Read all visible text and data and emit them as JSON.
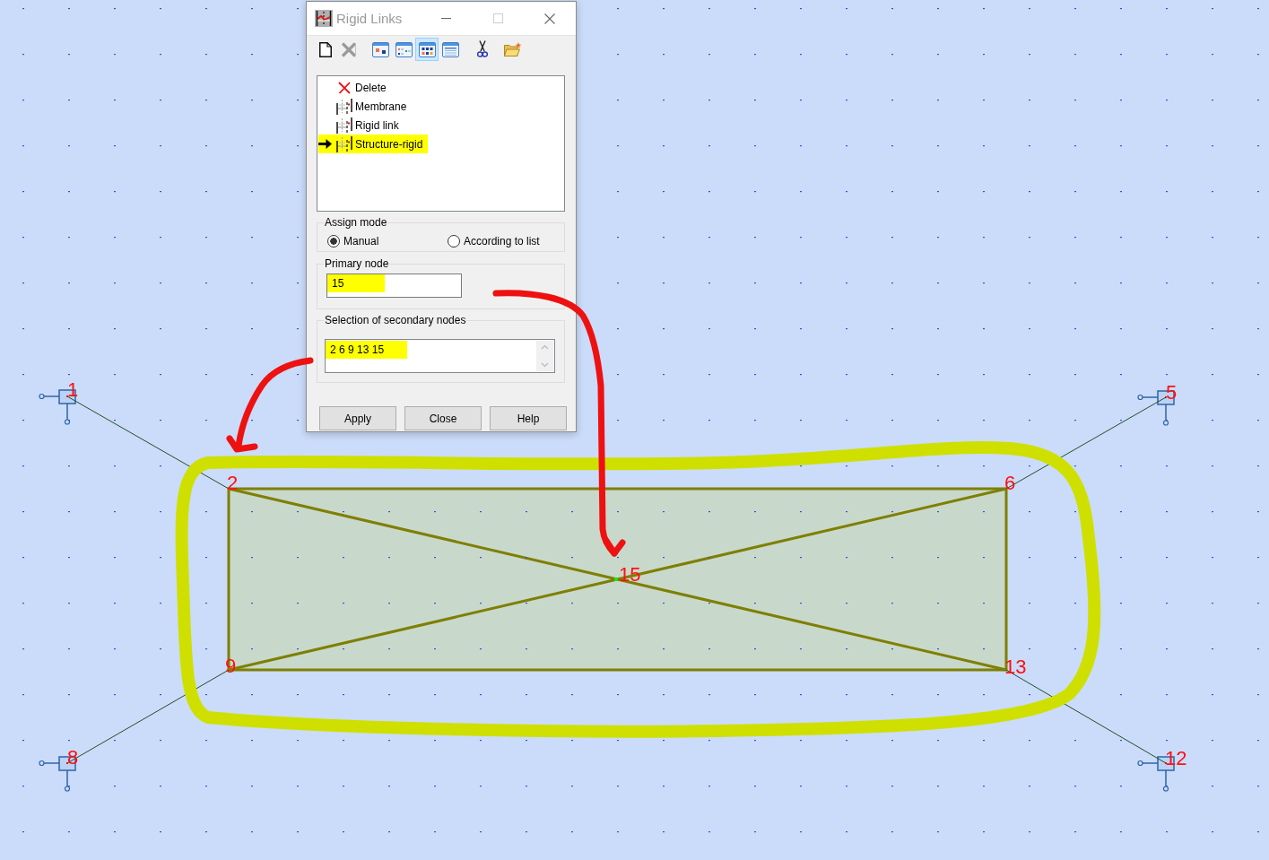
{
  "dialog": {
    "title": "Rigid Links",
    "active": false,
    "caption_buttons": [
      {
        "kind": "minimize",
        "disabled": false
      },
      {
        "kind": "maximize",
        "disabled": true
      },
      {
        "kind": "close",
        "disabled": false
      }
    ],
    "toolbar": [
      {
        "kind": "new",
        "selected": false,
        "disabled": false
      },
      {
        "kind": "delete",
        "selected": false,
        "disabled": true
      },
      {
        "kind": "view-large",
        "selected": false,
        "disabled": false
      },
      {
        "kind": "view-small",
        "selected": false,
        "disabled": false
      },
      {
        "kind": "view-grid",
        "selected": true,
        "disabled": false
      },
      {
        "kind": "view-details",
        "selected": false,
        "disabled": false
      },
      {
        "kind": "cut",
        "selected": false,
        "disabled": false
      },
      {
        "kind": "open",
        "selected": false,
        "disabled": false
      }
    ],
    "list": [
      {
        "label": "Delete",
        "kind": "delete",
        "selected": false,
        "highlighted": false
      },
      {
        "label": "Membrane",
        "kind": "link",
        "selected": false,
        "highlighted": false
      },
      {
        "label": "Rigid link",
        "kind": "link",
        "selected": false,
        "highlighted": false
      },
      {
        "label": "Structure-rigid",
        "kind": "link",
        "selected": true,
        "highlighted": true
      }
    ],
    "assign_mode": {
      "label": "Assign mode",
      "options": [
        {
          "label": "Manual",
          "selected": true
        },
        {
          "label": "According to list",
          "selected": false
        }
      ]
    },
    "primary_node": {
      "label": "Primary node",
      "value": "15",
      "highlighted": true
    },
    "secondary_nodes": {
      "label": "Selection of secondary nodes",
      "value": "2 6 9 13 15",
      "highlighted": true
    },
    "buttons": [
      "Apply",
      "Close",
      "Help"
    ]
  },
  "model_view": {
    "nodes": [
      {
        "label": "1",
        "kind": "support"
      },
      {
        "label": "5",
        "kind": "support"
      },
      {
        "label": "2",
        "kind": "corner"
      },
      {
        "label": "6",
        "kind": "corner"
      },
      {
        "label": "15",
        "kind": "center"
      },
      {
        "label": "9",
        "kind": "corner"
      },
      {
        "label": "13",
        "kind": "corner"
      },
      {
        "label": "8",
        "kind": "support"
      },
      {
        "label": "12",
        "kind": "support"
      }
    ],
    "annotations": [
      {
        "kind": "highlight-loop"
      },
      {
        "kind": "arrow"
      },
      {
        "kind": "arrow"
      }
    ]
  }
}
